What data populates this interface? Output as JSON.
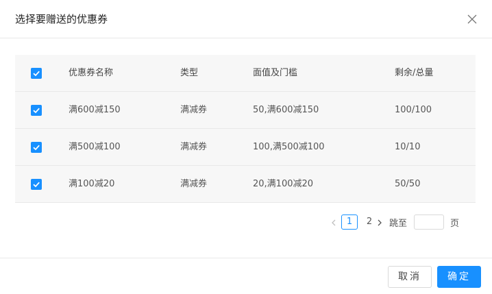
{
  "modal": {
    "title": "选择要赠送的优惠券"
  },
  "table": {
    "headers": {
      "name": "优惠券名称",
      "type": "类型",
      "value": "面值及门槛",
      "stock": "剩余/总量"
    },
    "rows": [
      {
        "name": "满600减150",
        "type": "满减券",
        "value": "50,满600减150",
        "stock": "100/100",
        "checked": true
      },
      {
        "name": "满500减100",
        "type": "满减券",
        "value": "100,满500减100",
        "stock": "10/10",
        "checked": true
      },
      {
        "name": "满100减20",
        "type": "满减券",
        "value": "20,满100减20",
        "stock": "50/50",
        "checked": true
      }
    ]
  },
  "pagination": {
    "pages": [
      "1",
      "2"
    ],
    "current": "1",
    "jump_label": "跳至",
    "page_label": "页",
    "jump_value": ""
  },
  "footer": {
    "cancel_label": "取消",
    "ok_label": "确定"
  },
  "colors": {
    "accent": "#1890ff",
    "row_bg": "#f7f7f7",
    "border": "#e8e8e8"
  }
}
